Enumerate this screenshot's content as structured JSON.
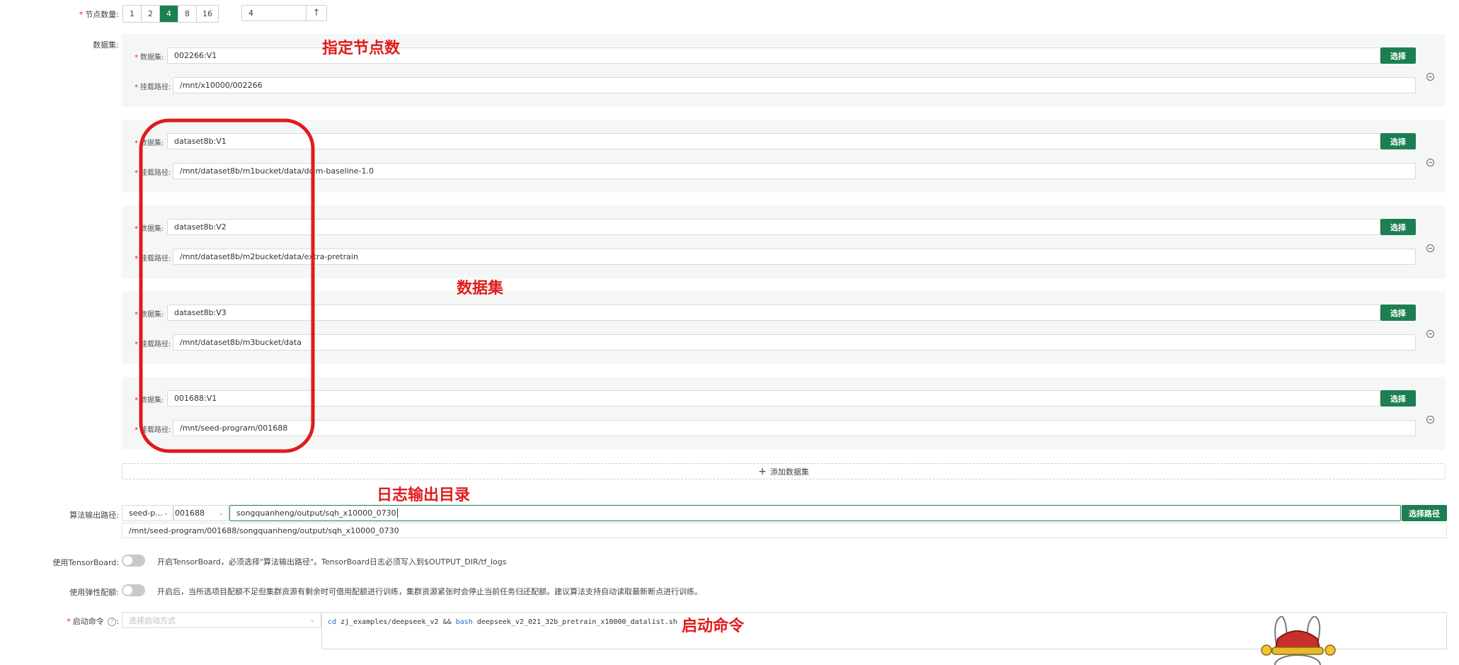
{
  "node_count": {
    "label": "节点数量:",
    "options": [
      "1",
      "2",
      "4",
      "8",
      "16"
    ],
    "selected": "4",
    "input_value": "4"
  },
  "datasets": {
    "label": "数据集:",
    "dataset_label": "数据集:",
    "mount_label": "挂载路径:",
    "select_button": "选择",
    "items": [
      {
        "dataset": "002266:V1",
        "mount": "/mnt/x10000/002266"
      },
      {
        "dataset": "dataset8b:V1",
        "mount": "/mnt/dataset8b/m1bucket/data/dclm-baseline-1.0"
      },
      {
        "dataset": "dataset8b:V2",
        "mount": "/mnt/dataset8b/m2bucket/data/extra-pretrain"
      },
      {
        "dataset": "dataset8b:V3",
        "mount": "/mnt/dataset8b/m3bucket/data"
      },
      {
        "dataset": "001688:V1",
        "mount": "/mnt/seed-program/001688"
      }
    ],
    "add_button": "添加数据集"
  },
  "output_path": {
    "label": "算法输出路径:",
    "select1": "seed-p...",
    "select2": "001688",
    "input_value": "songquanheng/output/sqh_x10000_0730",
    "full_path": "/mnt/seed-program/001688/songquanheng/output/sqh_x10000_0730",
    "button": "选择路径"
  },
  "tensorboard": {
    "label": "使用TensorBoard:",
    "hint": "开启TensorBoard，必须选择\"算法输出路径\"。TensorBoard日志必须写入到$OUTPUT_DIR/tf_logs"
  },
  "elastic": {
    "label": "使用弹性配额:",
    "hint": "开启后，当所选项目配额不足但集群资源有剩余时可借用配额进行训练，集群资源紧张时会停止当前任务归还配额。建议算法支持自动读取最新断点进行训练。"
  },
  "start_cmd": {
    "label": "启动命令",
    "help": "?",
    "select_placeholder": "选择启动方式",
    "cmd_cd": "cd",
    "cmd_path": " zj_examples/deepseek_v2 && ",
    "cmd_bash": "bash",
    "cmd_rest": " deepseek_v2_021_32b_pretrain_x10000_datalist.sh"
  },
  "annotations": {
    "node_note": "指定节点数",
    "dataset_note": "数据集",
    "log_note": "日志输出目录",
    "cmd_note": "启动命令"
  },
  "colors": {
    "primary": "#1c7f52",
    "required": "#e2231a",
    "annotation": "#e01b1b"
  }
}
